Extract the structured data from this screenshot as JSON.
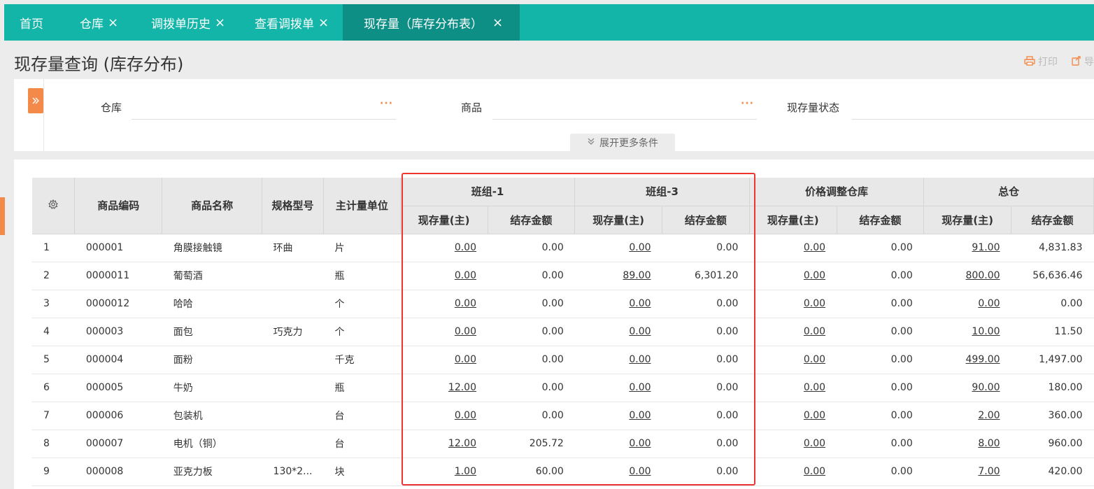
{
  "tabs": [
    {
      "label": "首页",
      "closable": false
    },
    {
      "label": "仓库",
      "closable": true
    },
    {
      "label": "调拨单历史",
      "closable": true
    },
    {
      "label": "查看调拨单",
      "closable": true
    },
    {
      "label": "现存量（库存分布表）",
      "closable": true,
      "active": true
    }
  ],
  "close_glyph": "×",
  "page_title": "现存量查询 (库存分布)",
  "actions": {
    "print": "打印",
    "export": "导"
  },
  "filters": {
    "warehouse_label": "仓库",
    "product_label": "商品",
    "status_label": "现存量状态",
    "dots": "···",
    "expand_label": "展开更多条件"
  },
  "table": {
    "headers": {
      "code": "商品编码",
      "name": "商品名称",
      "spec": "规格型号",
      "unit": "主计量单位",
      "qty": "现存量(主)",
      "amount": "结存金额"
    },
    "groups": [
      "班组-1",
      "班组-3",
      "价格调整仓库",
      "总仓"
    ],
    "rows": [
      {
        "idx": "1",
        "code": "000001",
        "name": "角膜接触镜",
        "spec": "环曲",
        "unit": "片",
        "g1q": "0.00",
        "g1a": "0.00",
        "g3q": "0.00",
        "g3a": "0.00",
        "pq": "0.00",
        "pa": "0.00",
        "tq": "91.00",
        "ta": "4,831.83"
      },
      {
        "idx": "2",
        "code": "0000011",
        "name": "葡萄酒",
        "spec": "",
        "unit": "瓶",
        "g1q": "0.00",
        "g1a": "0.00",
        "g3q": "89.00",
        "g3a": "6,301.20",
        "pq": "0.00",
        "pa": "0.00",
        "tq": "800.00",
        "ta": "56,636.46"
      },
      {
        "idx": "3",
        "code": "0000012",
        "name": "哈哈",
        "spec": "",
        "unit": "个",
        "g1q": "0.00",
        "g1a": "0.00",
        "g3q": "0.00",
        "g3a": "0.00",
        "pq": "0.00",
        "pa": "0.00",
        "tq": "0.00",
        "ta": "0.00"
      },
      {
        "idx": "4",
        "code": "000003",
        "name": "面包",
        "spec": "巧克力",
        "unit": "个",
        "g1q": "0.00",
        "g1a": "0.00",
        "g3q": "0.00",
        "g3a": "0.00",
        "pq": "0.00",
        "pa": "0.00",
        "tq": "10.00",
        "ta": "11.50"
      },
      {
        "idx": "5",
        "code": "000004",
        "name": "面粉",
        "spec": "",
        "unit": "千克",
        "g1q": "0.00",
        "g1a": "0.00",
        "g3q": "0.00",
        "g3a": "0.00",
        "pq": "0.00",
        "pa": "0.00",
        "tq": "499.00",
        "ta": "1,497.00"
      },
      {
        "idx": "6",
        "code": "000005",
        "name": "牛奶",
        "spec": "",
        "unit": "瓶",
        "g1q": "12.00",
        "g1a": "0.00",
        "g3q": "0.00",
        "g3a": "0.00",
        "pq": "0.00",
        "pa": "0.00",
        "tq": "90.00",
        "ta": "180.00"
      },
      {
        "idx": "7",
        "code": "000006",
        "name": "包装机",
        "spec": "",
        "unit": "台",
        "g1q": "0.00",
        "g1a": "0.00",
        "g3q": "0.00",
        "g3a": "0.00",
        "pq": "0.00",
        "pa": "0.00",
        "tq": "2.00",
        "ta": "360.00"
      },
      {
        "idx": "8",
        "code": "000007",
        "name": "电机（铜）",
        "spec": "",
        "unit": "台",
        "g1q": "12.00",
        "g1a": "205.72",
        "g3q": "0.00",
        "g3a": "0.00",
        "pq": "0.00",
        "pa": "0.00",
        "tq": "8.00",
        "ta": "960.00"
      },
      {
        "idx": "9",
        "code": "000008",
        "name": "亚克力板",
        "spec": "130*2...",
        "unit": "块",
        "g1q": "1.00",
        "g1a": "60.00",
        "g3q": "0.00",
        "g3a": "0.00",
        "pq": "0.00",
        "pa": "0.00",
        "tq": "7.00",
        "ta": "420.00"
      }
    ]
  },
  "colors": {
    "tabbar": "#12b5a8",
    "tab_active": "#0e8f86",
    "accent": "#f48a4a",
    "highlight": "#e33333"
  },
  "icons": {
    "settings": "gear-icon",
    "print": "printer-icon",
    "expand": "double-chevron-down-icon",
    "toggle": "double-chevron-right-icon"
  }
}
